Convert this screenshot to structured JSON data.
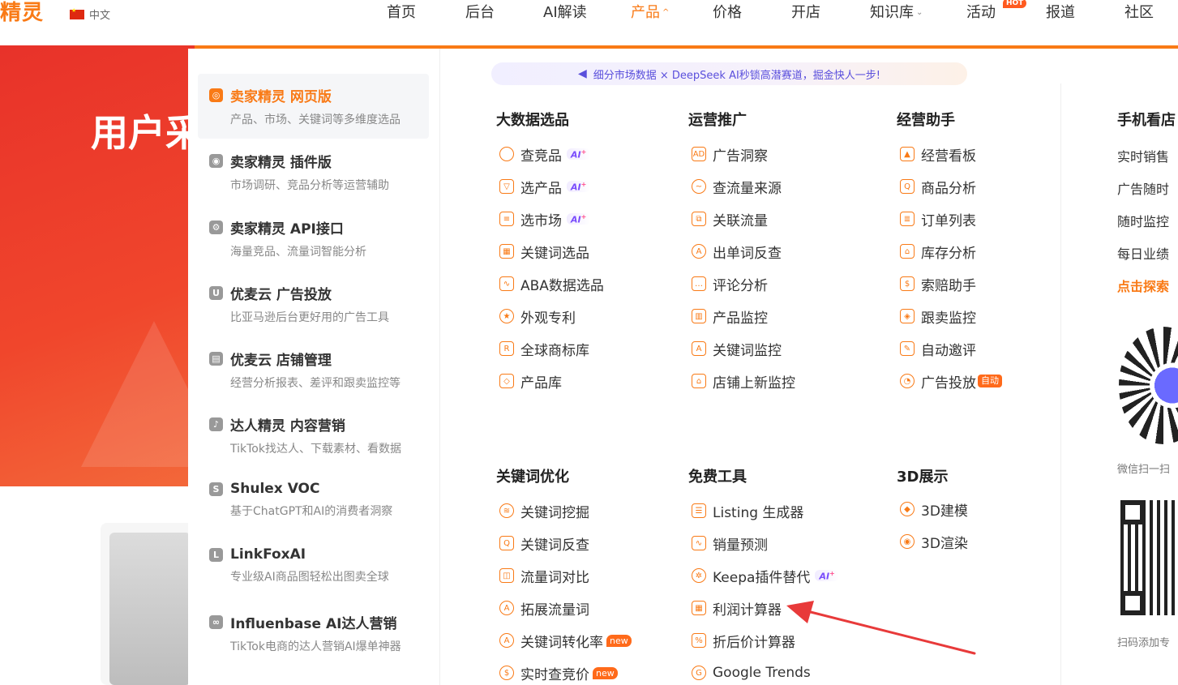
{
  "nav": {
    "logo": "精灵",
    "lang": "中文",
    "items": [
      "首页",
      "后台",
      "AI解读",
      "产品",
      "价格",
      "开店",
      "知识库",
      "活动",
      "报道",
      "社区"
    ],
    "hot_badge": "HOT"
  },
  "hero": {
    "title": "用户采"
  },
  "left_products": [
    {
      "title": "卖家精灵 网页版",
      "desc": "产品、市场、关键词等多维度选品"
    },
    {
      "title": "卖家精灵 插件版",
      "desc": "市场调研、竞品分析等运营辅助"
    },
    {
      "title": "卖家精灵 API接口",
      "desc": "海量竞品、流量词智能分析"
    },
    {
      "title": "优麦云 广告投放",
      "desc": "比亚马逊后台更好用的广告工具"
    },
    {
      "title": "优麦云 店铺管理",
      "desc": "经营分析报表、差评和跟卖监控等"
    },
    {
      "title": "达人精灵 内容营销",
      "desc": "TikTok找达人、下载素材、看数据"
    },
    {
      "title": "Shulex VOC",
      "desc": "基于ChatGPT和AI的消费者洞察"
    },
    {
      "title": "LinkFoxAI",
      "desc": "专业级AI商品图轻松出图卖全球"
    },
    {
      "title": "Influenbase AI达人营销",
      "desc": "TikTok电商的达人营销AI爆单神器"
    }
  ],
  "banner": "细分市场数据 × DeepSeek AI秒锁高潜赛道，掘金快人一步!",
  "columns": {
    "big_data": {
      "title": "大数据选品",
      "items": [
        "查竞品",
        "选产品",
        "选市场",
        "关键词选品",
        "ABA数据选品",
        "外观专利",
        "全球商标库",
        "产品库"
      ]
    },
    "operations": {
      "title": "运营推广",
      "items": [
        "广告洞察",
        "查流量来源",
        "关联流量",
        "出单词反查",
        "评论分析",
        "产品监控",
        "关键词监控",
        "店铺上新监控"
      ]
    },
    "business": {
      "title": "经营助手",
      "items": [
        "经营看板",
        "商品分析",
        "订单列表",
        "库存分析",
        "索赔助手",
        "跟卖监控",
        "自动邀评",
        "广告投放"
      ]
    },
    "keyword_opt": {
      "title": "关键词优化",
      "items": [
        "关键词挖掘",
        "关键词反查",
        "流量词对比",
        "拓展流量词",
        "关键词转化率",
        "实时查竞价"
      ]
    },
    "free_tools": {
      "title": "免费工具",
      "items": [
        "Listing 生成器",
        "销量预测",
        "Keepa插件替代",
        "利润计算器",
        "折后价计算器",
        "Google Trends"
      ]
    },
    "display_3d": {
      "title": "3D展示",
      "items": [
        "3D建模",
        "3D渲染"
      ]
    }
  },
  "badges": {
    "ai": "AI",
    "new": "new",
    "auto": "自动"
  },
  "mobile": {
    "title": "手机看店",
    "lines": [
      "实时销售",
      "广告随时",
      "随时监控",
      "每日业绩"
    ],
    "link": "点击探索",
    "caption1": "微信扫一扫",
    "caption2": "扫码添加专"
  },
  "colors": {
    "accent": "#f97a16",
    "ai_purple": "#7a4dfc",
    "hero_red": "#e8322a"
  }
}
